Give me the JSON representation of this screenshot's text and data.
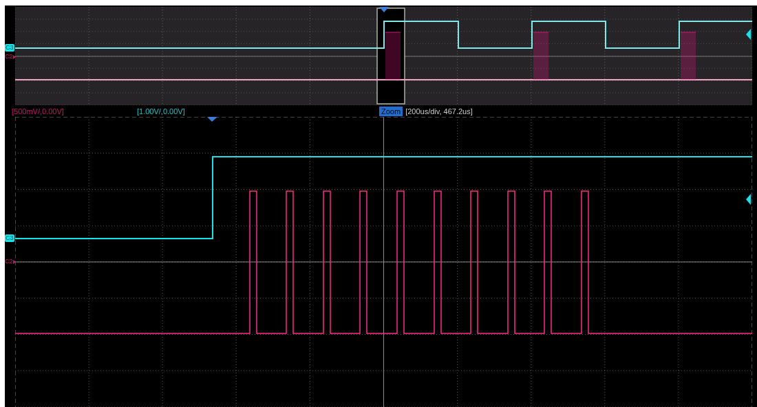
{
  "overview": {
    "markers": [
      {
        "label": "C3",
        "kind": "badge",
        "color": "#19e3e8"
      },
      {
        "label": "C2",
        "kind": "arrow",
        "color": "#d0106a"
      }
    ]
  },
  "info_bar": {
    "scales": [
      {
        "text": "[500mV/,0.00V]",
        "color": "#d0106a"
      },
      {
        "text": "[1.00V/,0.00V]",
        "color": "#19c8cc"
      }
    ],
    "zoom_badge": "Zoom",
    "timebase": "[200us/div, 467.2us]"
  },
  "zoom_view": {
    "markers": [
      {
        "label": "C3",
        "kind": "badge",
        "color": "#19e3e8"
      },
      {
        "label": "C2",
        "kind": "arrow",
        "color": "#d0106a"
      }
    ]
  }
}
